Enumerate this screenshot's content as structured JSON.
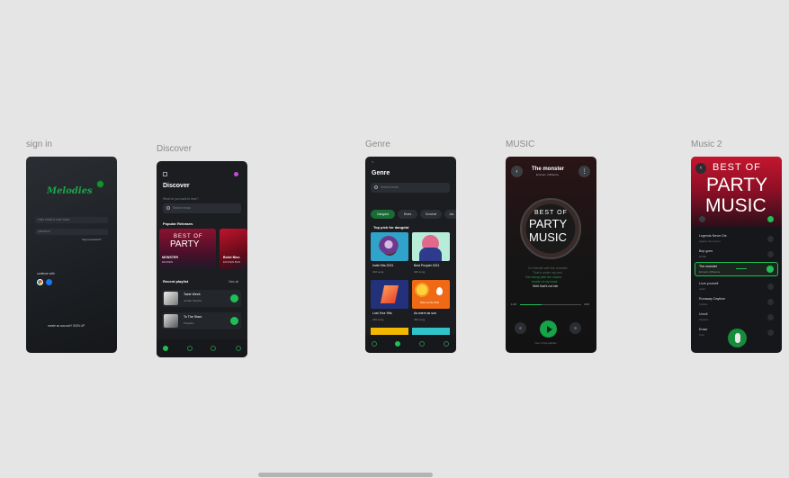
{
  "frames": {
    "signin": "sign in",
    "discover": "Discover",
    "genre": "Genre",
    "music": "MUSIC",
    "music2": "Music 2"
  },
  "signin": {
    "logo": "Melodies",
    "email_placeholder": "enter email or user name",
    "password_placeholder": "password",
    "forgot": "forgot password",
    "continue_with": "continue with",
    "signup": "create an account? SIGN UP"
  },
  "discover": {
    "title": "Discover",
    "search_label": "What do you want to hear?",
    "search_placeholder": "Search music",
    "popular_heading": "Popular Releases",
    "cover_line1": "BEST OF",
    "cover_line2": "PARTY",
    "release1_title": "MONSTER",
    "release1_artist": "ENJOEN",
    "release2_title": "Bohrt Bion",
    "release2_artist": "ENJOEN BAS",
    "recent_heading": "Recent playlist",
    "view_all": "View all",
    "recent": [
      {
        "title": "Taste Week",
        "artist": "Jordan Sandhu"
      },
      {
        "title": "To The Stars",
        "artist": "Prayfaim"
      }
    ]
  },
  "genre": {
    "back": "<",
    "title": "Genre",
    "search_placeholder": "Search music",
    "chips": [
      "Dangdut",
      "Blues",
      "Sunchat",
      "Jaz"
    ],
    "top_heading": "Top pick for dangdut",
    "cards": [
      {
        "title": "Indie Hits 2021",
        "count": "340 song"
      },
      {
        "title": "Best Punjabi 2021",
        "count": "340 song"
      },
      {
        "title": "Lost Your Hits",
        "count": "340 song"
      },
      {
        "title": "As warm as sun",
        "count": "340 song"
      }
    ],
    "sun_caption": "Warm as the SUN"
  },
  "music": {
    "song_title": "The monster",
    "artist": "Eminem | Rihanna",
    "cover_line1": "BEST OF",
    "cover_line2": "PARTY",
    "cover_line3": "MUSIC",
    "lyrics": [
      "I'm friends with the monster",
      "That's under my bed",
      "Get along with the voices",
      "Inside of my head",
      "Well that's not fair"
    ],
    "time_current": "1:43",
    "time_total": "4:23",
    "footer": "Your of the playlist"
  },
  "music2": {
    "cover_line1": "BEST OF",
    "cover_line2": "PARTY",
    "cover_line3": "MUSIC",
    "songs": [
      {
        "title": "Legends Never Die",
        "artist": "Against the current"
      },
      {
        "title": "Bop goes",
        "artist": "EUNE"
      },
      {
        "title": "The monster",
        "artist": "Eminem | Rihanna"
      },
      {
        "title": "Love yourself",
        "artist": "Justin"
      },
      {
        "title": "Runaway Daytime",
        "artist": "Coldme"
      },
      {
        "title": "Unroll",
        "artist": "Capsule"
      },
      {
        "title": "Erase",
        "artist": "Tyler"
      }
    ]
  },
  "colors": {
    "canvas": "#e5e5e5",
    "frame_bg": "#1b1d21",
    "accent_green": "#1fbf54",
    "dark_green": "#0e3a1f"
  }
}
